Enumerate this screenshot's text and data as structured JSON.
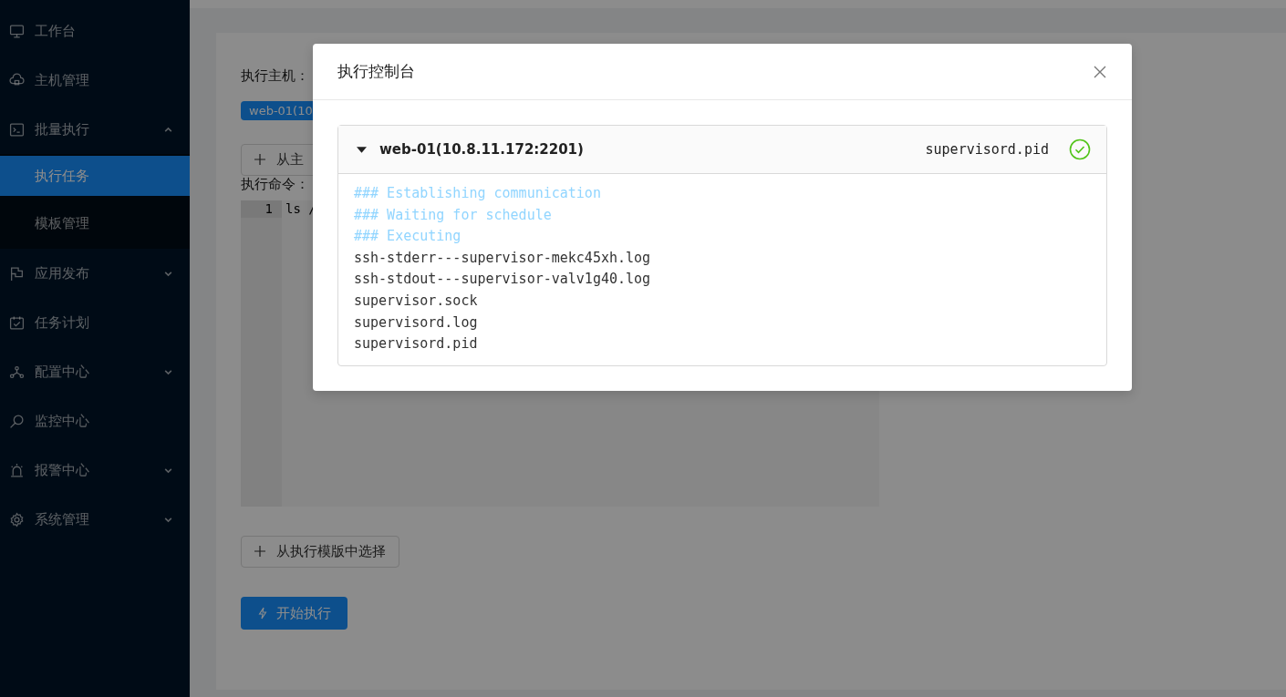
{
  "sidebar": {
    "items": [
      {
        "kind": "item",
        "label": "工作台"
      },
      {
        "kind": "item",
        "label": "主机管理"
      },
      {
        "kind": "group",
        "label": "批量执行",
        "expanded": true,
        "children": [
          {
            "label": "执行任务",
            "selected": true
          },
          {
            "label": "模板管理",
            "selected": false
          }
        ]
      },
      {
        "kind": "group",
        "label": "应用发布",
        "expanded": false
      },
      {
        "kind": "item",
        "label": "任务计划"
      },
      {
        "kind": "group",
        "label": "配置中心",
        "expanded": false
      },
      {
        "kind": "item",
        "label": "监控中心"
      },
      {
        "kind": "group",
        "label": "报警中心",
        "expanded": false
      },
      {
        "kind": "group",
        "label": "系统管理",
        "expanded": false
      }
    ]
  },
  "form": {
    "host_label": "执行主机：",
    "host_tags": [
      "web-01(10"
    ],
    "add_host_button": "从主",
    "command_label": "执行命令：",
    "editor_lines": [
      {
        "number": "1",
        "text": "ls /"
      }
    ],
    "template_button": "从执行模版中选择",
    "start_button": "开始执行"
  },
  "modal": {
    "title": "执行控制台",
    "panel": {
      "host": "web-01(10.8.11.172:2201)",
      "expanded": true,
      "last_line": "supervisord.pid",
      "success": true,
      "output": [
        {
          "kind": "info",
          "text": "### Establishing communication"
        },
        {
          "kind": "info",
          "text": "### Waiting for schedule"
        },
        {
          "kind": "info",
          "text": "### Executing"
        },
        {
          "kind": "out",
          "text": "ssh-stderr---supervisor-mekc45xh.log"
        },
        {
          "kind": "out",
          "text": "ssh-stdout---supervisor-valv1g40.log"
        },
        {
          "kind": "out",
          "text": "supervisor.sock"
        },
        {
          "kind": "out",
          "text": "supervisord.log"
        },
        {
          "kind": "out",
          "text": "supervisord.pid"
        }
      ]
    }
  }
}
